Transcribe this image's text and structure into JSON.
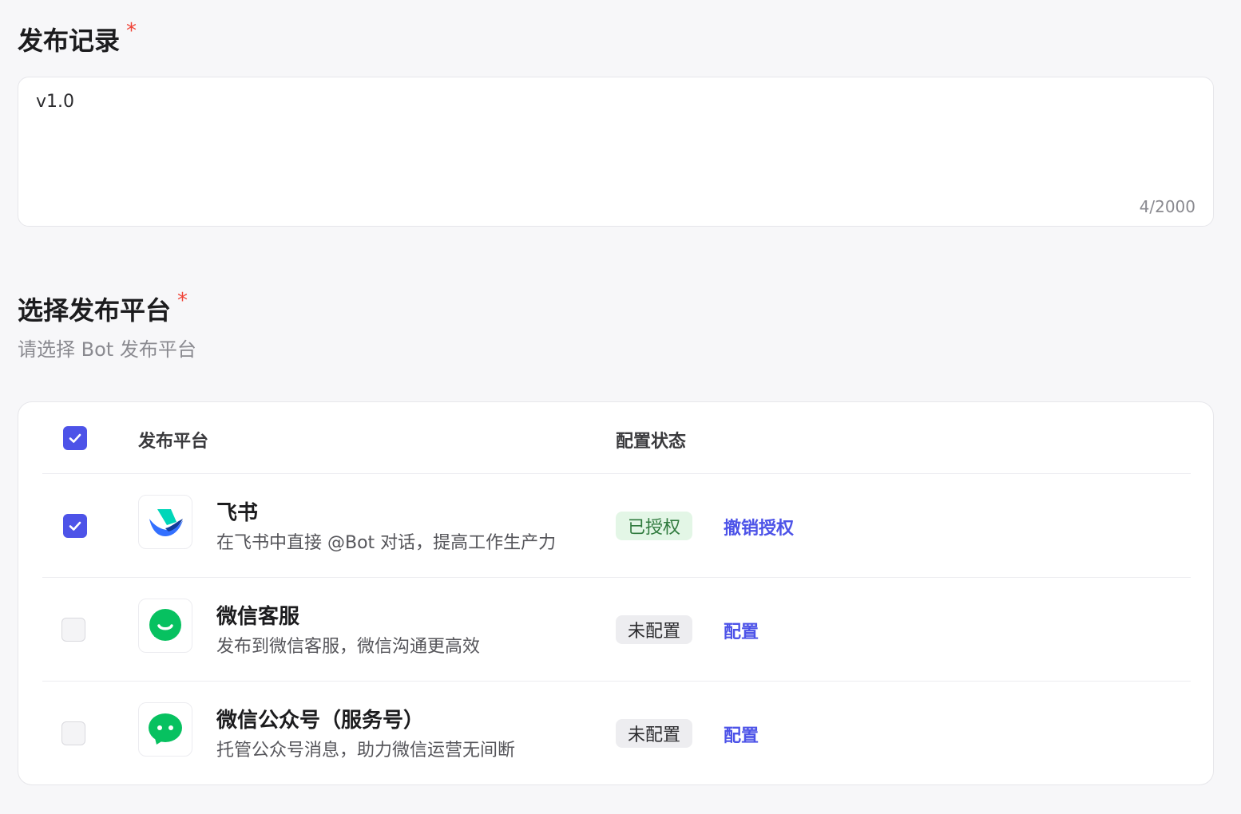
{
  "record": {
    "title": "发布记录",
    "required_mark": "*",
    "value": "v1.0",
    "char_count": "4/2000"
  },
  "platform": {
    "title": "选择发布平台",
    "required_mark": "*",
    "subtitle": "请选择 Bot 发布平台"
  },
  "table": {
    "header": {
      "col_platform": "发布平台",
      "col_status": "配置状态",
      "select_all_checked": true
    },
    "rows": [
      {
        "name": "飞书",
        "desc": "在飞书中直接 @Bot 对话，提高工作生产力",
        "status": "已授权",
        "action": "撤销授权",
        "checked": true,
        "icon": "feishu-icon"
      },
      {
        "name": "微信客服",
        "desc": "发布到微信客服，微信沟通更高效",
        "status": "未配置",
        "action": "配置",
        "checked": false,
        "icon": "wechat-customer-service-icon"
      },
      {
        "name": "微信公众号（服务号）",
        "desc": "托管公众号消息，助力微信运营无间断",
        "status": "未配置",
        "action": "配置",
        "checked": false,
        "icon": "wechat-official-account-icon"
      }
    ]
  },
  "colors": {
    "accent": "#4d53e8",
    "required": "#f04438",
    "authorized_bg": "#e3f6e6",
    "authorized_text": "#2f7a3d",
    "wechat_green": "#07c160"
  }
}
